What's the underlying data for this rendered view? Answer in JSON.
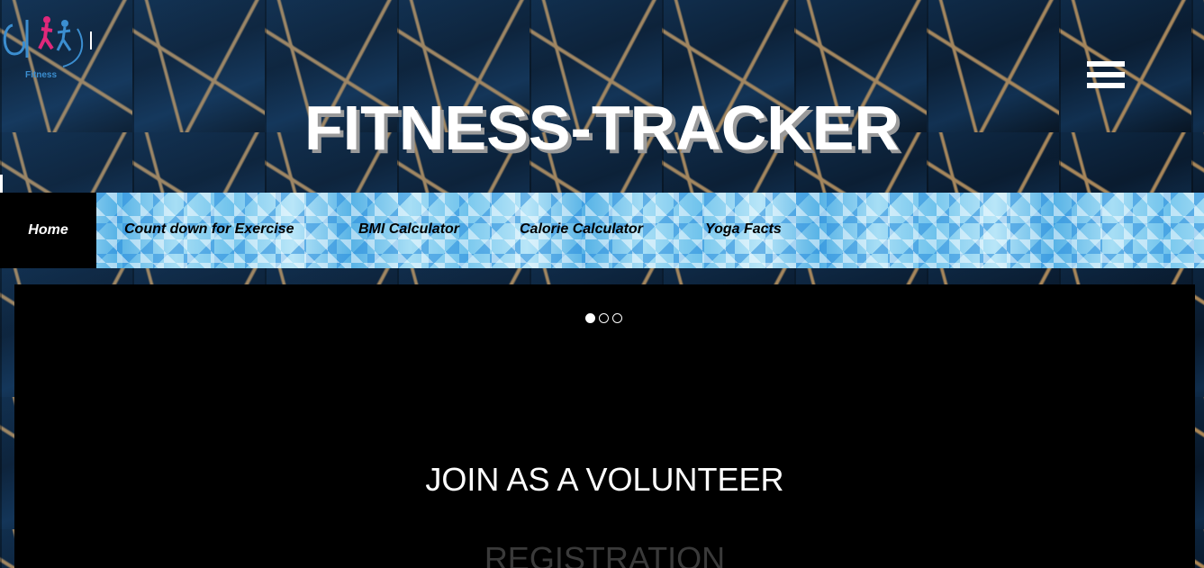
{
  "header": {
    "logo_text": "Fitness",
    "site_title": "FITNESS-TRACKER",
    "menu_icon": "hamburger-menu-icon"
  },
  "nav": {
    "items": [
      {
        "label": "Home",
        "active": true
      },
      {
        "label": "Count down for Exercise"
      },
      {
        "label": "BMI Calculator"
      },
      {
        "label": "Calorie Calculator"
      },
      {
        "label": "Yoga Facts"
      }
    ]
  },
  "hero": {
    "slides_total": 3,
    "active_slide": 1,
    "heading": "JOIN AS A VOLUNTEER",
    "subheading": "REGISTRATION"
  },
  "colors": {
    "title_text": "#ffffff",
    "title_shadow": "#9a9a9a",
    "nav_active_bg": "#000000",
    "panel_bg": "#000000",
    "logo_blue": "#3b8ed0",
    "logo_pink": "#e0287a"
  }
}
